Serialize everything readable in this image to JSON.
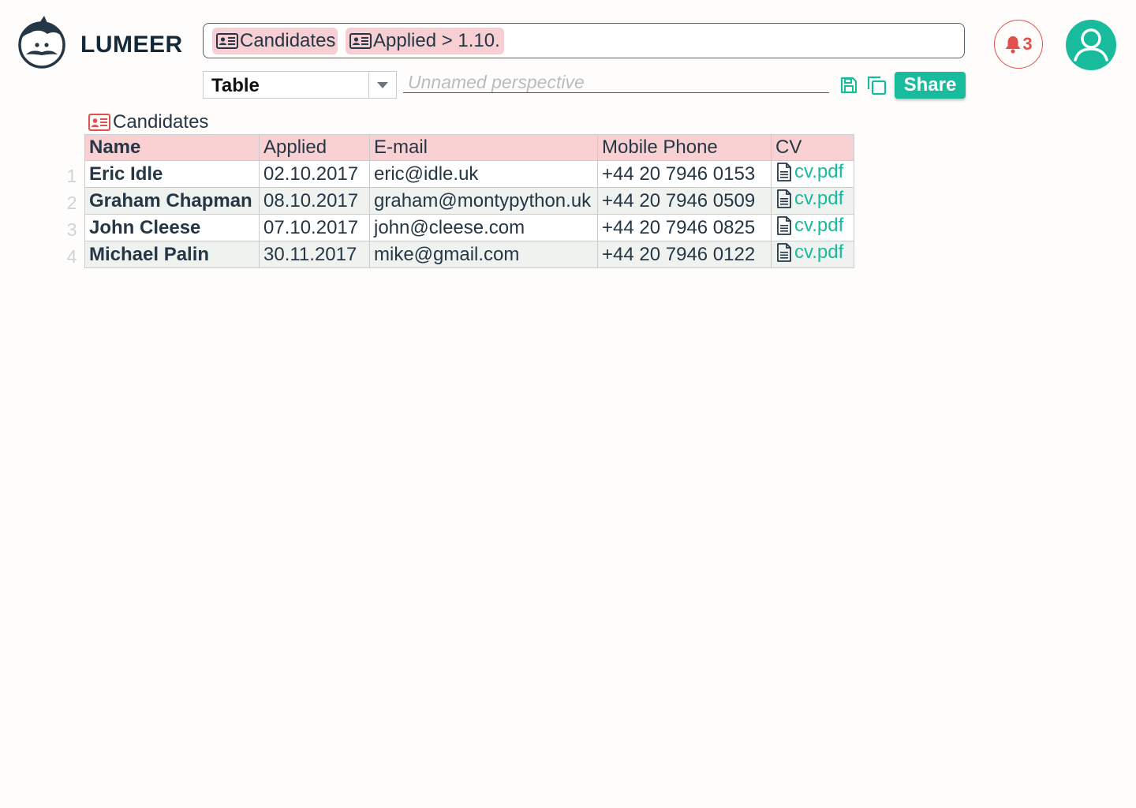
{
  "app": {
    "name": "LUMEER",
    "notifications_count": "3"
  },
  "search": {
    "chips": [
      {
        "label": "Candidates",
        "icon": "id-card-icon"
      },
      {
        "label": "Applied > 1.10.",
        "icon": "id-card-icon"
      }
    ]
  },
  "toolbar": {
    "view": "Table",
    "perspective_placeholder": "Unnamed perspective",
    "share_label": "Share"
  },
  "table": {
    "title": "Candidates",
    "columns": [
      "Name",
      "Applied",
      "E-mail",
      "Mobile Phone",
      "CV"
    ],
    "rows": [
      {
        "num": "1",
        "name": "Eric Idle",
        "applied": "02.10.2017",
        "email": "eric@idle.uk",
        "phone": "+44 20 7946 0153",
        "cv": "cv.pdf"
      },
      {
        "num": "2",
        "name": "Graham Chapman",
        "applied": "08.10.2017",
        "email": "graham@montypython.uk",
        "phone": "+44 20 7946 0509",
        "cv": "cv.pdf"
      },
      {
        "num": "3",
        "name": "John Cleese",
        "applied": "07.10.2017",
        "email": "john@cleese.com",
        "phone": "+44 20 7946 0825",
        "cv": "cv.pdf"
      },
      {
        "num": "4",
        "name": "Michael Palin",
        "applied": "30.11.2017",
        "email": "mike@gmail.com",
        "phone": "+44 20 7946 0122",
        "cv": "cv.pdf"
      }
    ]
  },
  "colors": {
    "accent": "#18bc9c",
    "alert": "#e2504c",
    "chip": "#f7cfd2",
    "header": "#f9d1d3",
    "text": "#253746"
  }
}
